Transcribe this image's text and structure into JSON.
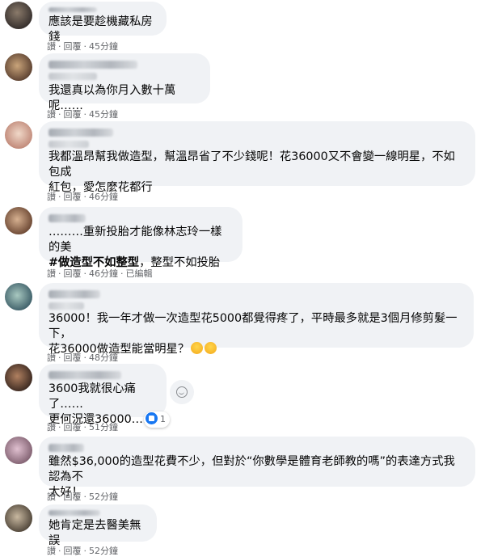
{
  "comments": [
    {
      "text_lines": [
        "應該是要趁機藏私房錢"
      ],
      "actions": {
        "reply_short": "讃",
        "reply": "回覆",
        "time": "45分鐘"
      }
    },
    {
      "text_lines": [
        "我還真以為你月入數十萬呢……"
      ],
      "actions": {
        "reply_short": "讃",
        "reply": "回覆",
        "time": "45分鐘"
      }
    },
    {
      "text_lines": [
        "我都溫昂幫我做造型，幫溫昂省了不少錢呢！花36000又不會變一線明星，不如包成",
        "紅包，愛怎麼花都行"
      ],
      "actions": {
        "reply_short": "讃",
        "reply": "回覆",
        "time": "46分鐘"
      }
    },
    {
      "text_lines": [
        "………重新投胎才能像林志玲一樣的美"
      ],
      "hashtag": "#做造型不如整型",
      "hashtag_rest": "，整型不如投胎",
      "actions": {
        "reply_short": "讃",
        "reply": "回覆",
        "time": "46分鐘",
        "edited": "已編輯"
      }
    },
    {
      "text_lines": [
        "36000！我一年才做一次造型花5000都覺得疼了，平時最多就是3個月修剪髮一下，",
        "花36000做造型能當明星？"
      ],
      "actions": {
        "reply_short": "讃",
        "reply": "回覆",
        "time": "48分鐘"
      }
    },
    {
      "text_lines": [
        "3600我就很心痛了……",
        "更何況還36000……"
      ],
      "actions": {
        "reply_short": "讃",
        "reply": "回覆",
        "time": "51分鐘"
      },
      "reaction_count": "1"
    },
    {
      "text_lines": [
        "雖然$36,000的造型花費不少，但對於“你數學是體育老師教的嗎”的表達方式我認為不",
        "太好！"
      ],
      "actions": {
        "reply_short": "讃",
        "reply": "回覆",
        "time": "52分鐘"
      }
    },
    {
      "text_lines": [
        "她肯定是去醫美無誤"
      ],
      "actions": {
        "reply_short": "讃",
        "reply": "回覆",
        "time": "52分鐘"
      }
    }
  ],
  "colors": {
    "bubble": "#f0f2f5",
    "meta_text": "#65676b",
    "like_blue": "#1877f2"
  },
  "icons": [
    "like-reaction-icon",
    "add-reaction-icon",
    "sweat-smile-emoji-icon",
    "laughing-emoji-icon"
  ]
}
